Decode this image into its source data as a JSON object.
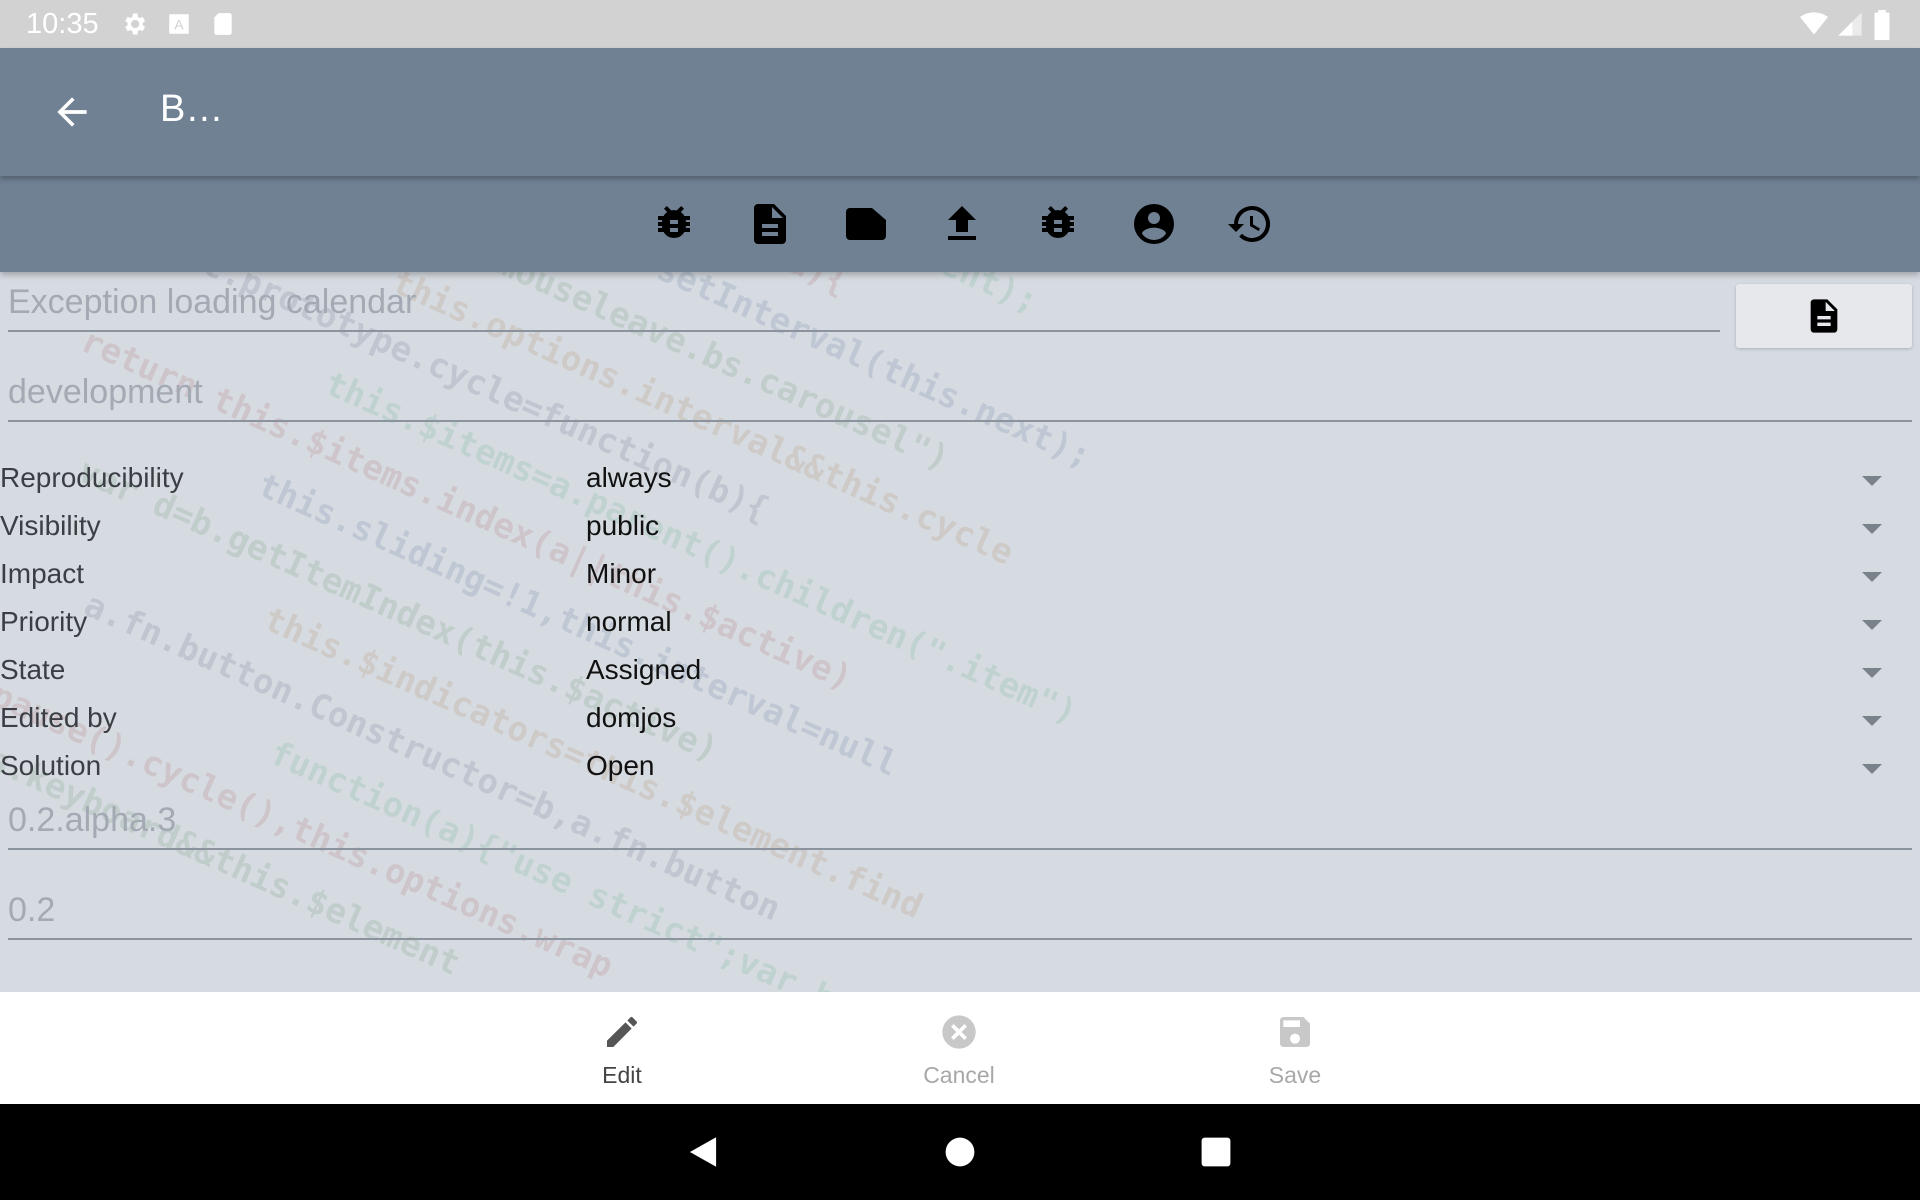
{
  "status_bar": {
    "time": "10:35",
    "icons": [
      "gear-icon",
      "font-a-icon",
      "sd-card-icon",
      "wifi-icon",
      "signal-icon",
      "battery-icon"
    ]
  },
  "app_bar": {
    "title": "B…",
    "back_icon": "arrow-back-icon"
  },
  "tabs": [
    {
      "icon": "bug-icon"
    },
    {
      "icon": "document-icon"
    },
    {
      "icon": "label-tag-icon"
    },
    {
      "icon": "upload-icon"
    },
    {
      "icon": "bug-icon"
    },
    {
      "icon": "account-circle-icon"
    },
    {
      "icon": "history-icon"
    }
  ],
  "form": {
    "summary": "Exception loading calendar",
    "category": "development",
    "version": "0.2.alpha.3",
    "target_version": "0.2",
    "rows": [
      {
        "label": "Reproducibility",
        "value": "always"
      },
      {
        "label": "Visibility",
        "value": "public"
      },
      {
        "label": "Impact",
        "value": "Minor"
      },
      {
        "label": "Priority",
        "value": "normal"
      },
      {
        "label": "State",
        "value": "Assigned"
      },
      {
        "label": "Edited by",
        "value": "domjos"
      },
      {
        "label": "Solution",
        "value": "Open"
      }
    ]
  },
  "actions": {
    "edit": "Edit",
    "cancel": "Cancel",
    "save": "Save"
  },
  "colors": {
    "app_bar": "#6f8193",
    "status_bar": "#d2d2d2",
    "content_bg": "#d6dbe2"
  }
}
